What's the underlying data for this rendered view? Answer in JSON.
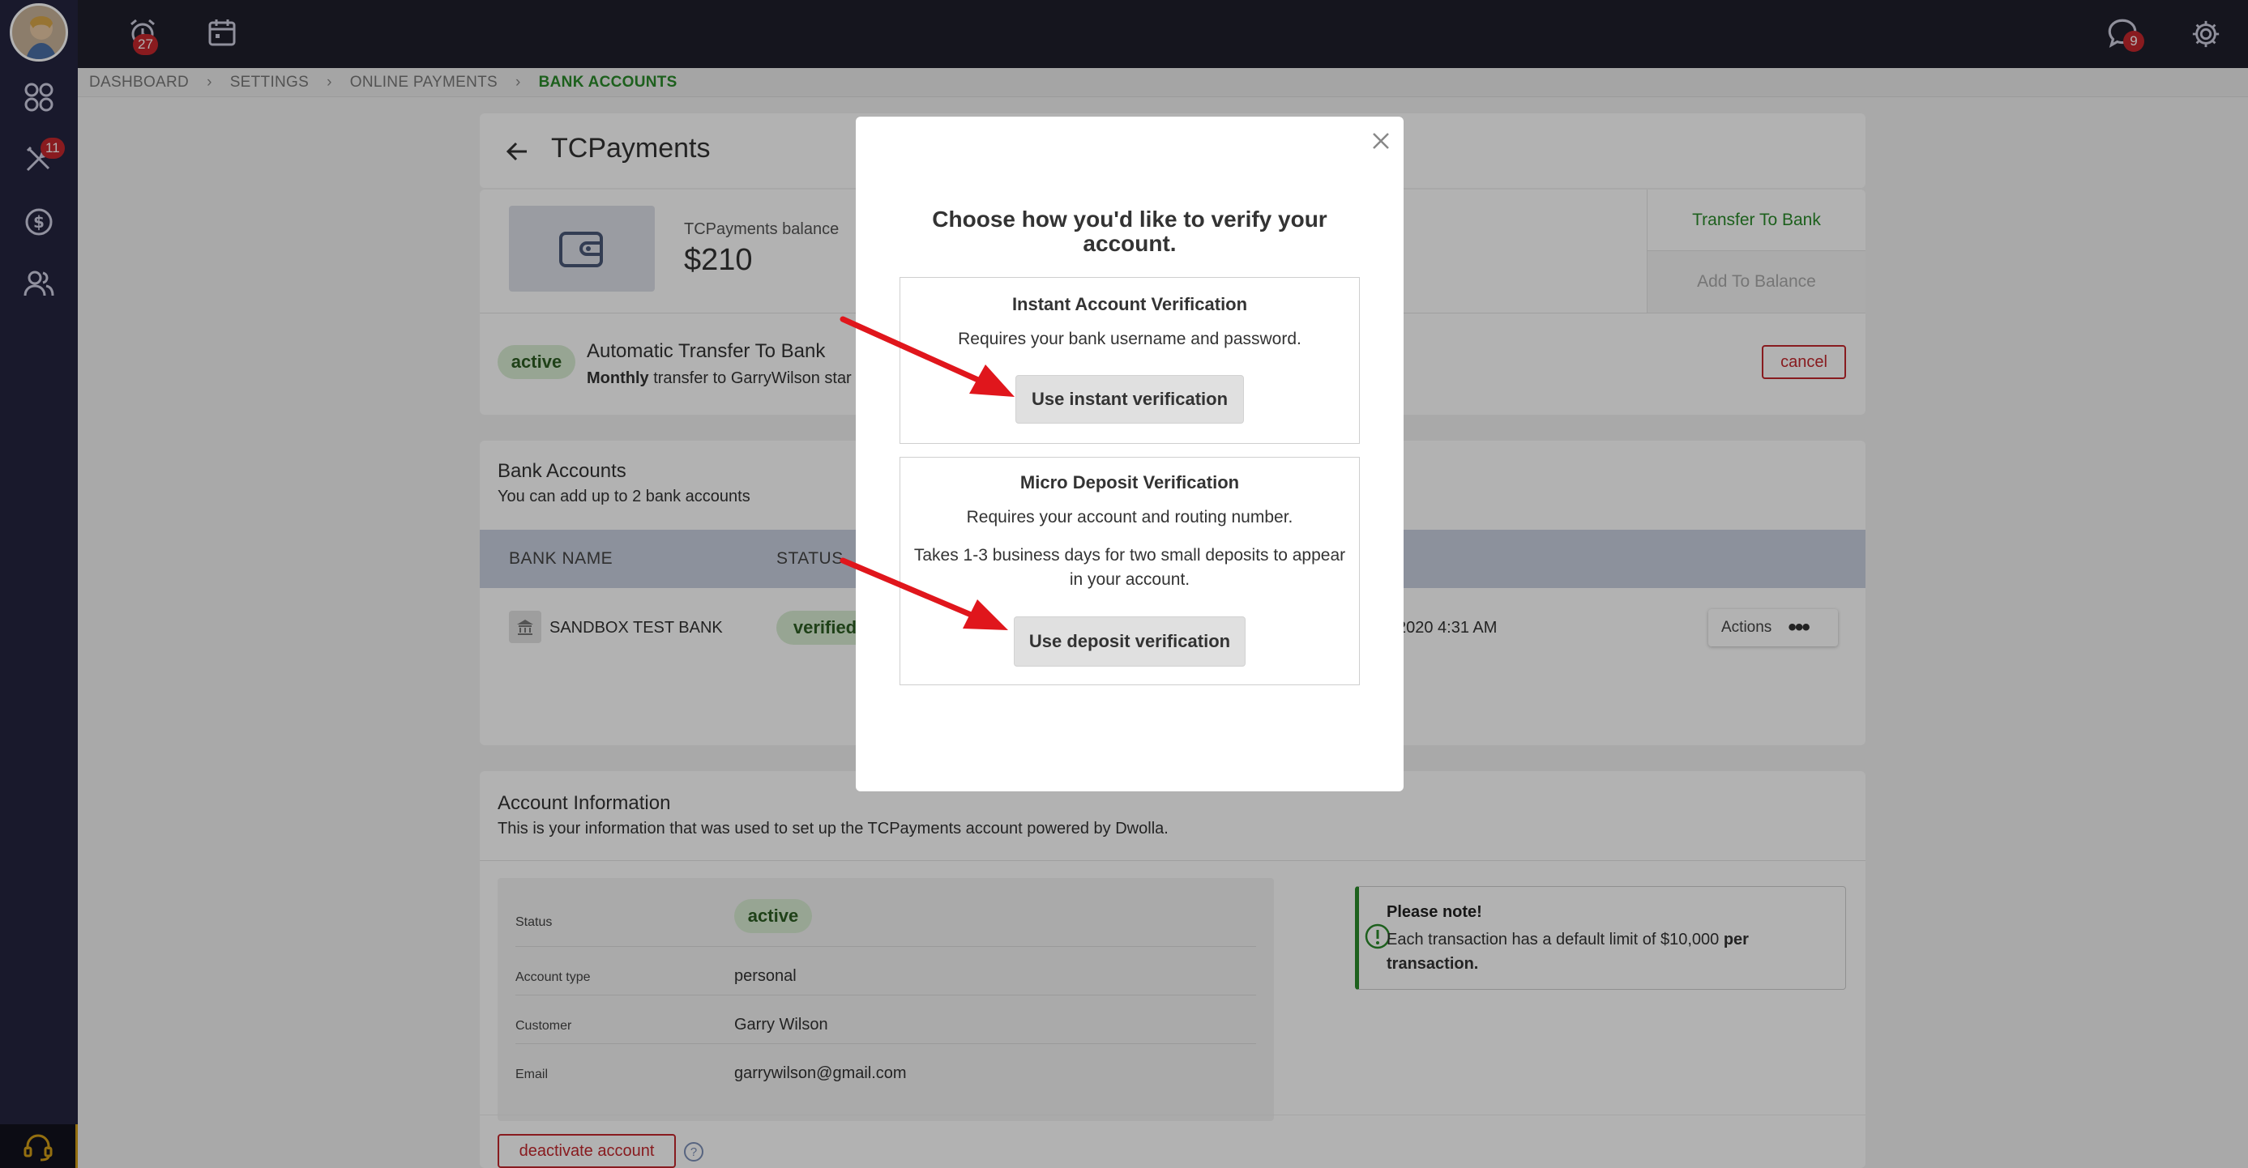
{
  "topbar": {
    "alarm_badge": "27",
    "chat_badge": "9"
  },
  "sidebar": {
    "tools_badge": "11"
  },
  "breadcrumb": [
    "DASHBOARD",
    "SETTINGS",
    "ONLINE PAYMENTS",
    "BANK ACCOUNTS"
  ],
  "page": {
    "title": "TCPayments"
  },
  "balance": {
    "label": "TCPayments balance",
    "amount": "$210",
    "transfer_button": "Transfer To Bank",
    "add_button": "Add To Balance"
  },
  "auto_transfer": {
    "status": "active",
    "title": "Automatic Transfer To Bank",
    "frequency": "Monthly",
    "description": "transfer to GarryWilson star",
    "cancel_label": "cancel"
  },
  "bank_accounts": {
    "title": "Bank Accounts",
    "subtitle": "You can add up to 2 bank accounts",
    "columns": [
      "BANK NAME",
      "STATUS"
    ],
    "rows": [
      {
        "name": "SANDBOX TEST BANK",
        "status": "verified",
        "date": "2020 4:31 AM",
        "actions_label": "Actions"
      }
    ]
  },
  "account_info": {
    "title": "Account Information",
    "subtitle": "This is your information that was used to set up the TCPayments account powered by Dwolla.",
    "fields": [
      {
        "label": "Status",
        "value": "active"
      },
      {
        "label": "Account type",
        "value": "personal"
      },
      {
        "label": "Customer",
        "value": "Garry Wilson"
      },
      {
        "label": "Email",
        "value": "garrywilson@gmail.com"
      }
    ],
    "note_title": "Please note!",
    "note_text_1": "Each transaction has a default limit of $10,000 ",
    "note_text_bold": "per",
    "note_text_2": "transaction.",
    "deactivate_label": "deactivate account"
  },
  "modal": {
    "title_line1": "Choose how you'd like to verify your",
    "title_line2": "account.",
    "instant": {
      "heading": "Instant Account Verification",
      "description": "Requires your bank username and password.",
      "button": "Use instant verification"
    },
    "micro": {
      "heading": "Micro Deposit Verification",
      "description": "Requires your account and routing number.",
      "description2_line1": "Takes 1-3 business days for two small deposits to appear",
      "description2_line2": "in your account.",
      "button": "Use deposit verification"
    }
  },
  "colors": {
    "accent_green": "#2a8a2a",
    "danger_red": "#c3272d",
    "annotation_arrow": "#e0161c",
    "sidebar": "#252540",
    "topbar": "#1f1f2b"
  },
  "icons": [
    "alarm-clock-icon",
    "calendar-icon",
    "apps-grid-icon",
    "tools-icon",
    "dollar-icon",
    "users-icon",
    "headset-icon",
    "chat-icon",
    "gear-icon",
    "wallet-icon",
    "bank-icon",
    "back-arrow-icon",
    "close-icon",
    "info-circle-icon",
    "help-icon"
  ]
}
